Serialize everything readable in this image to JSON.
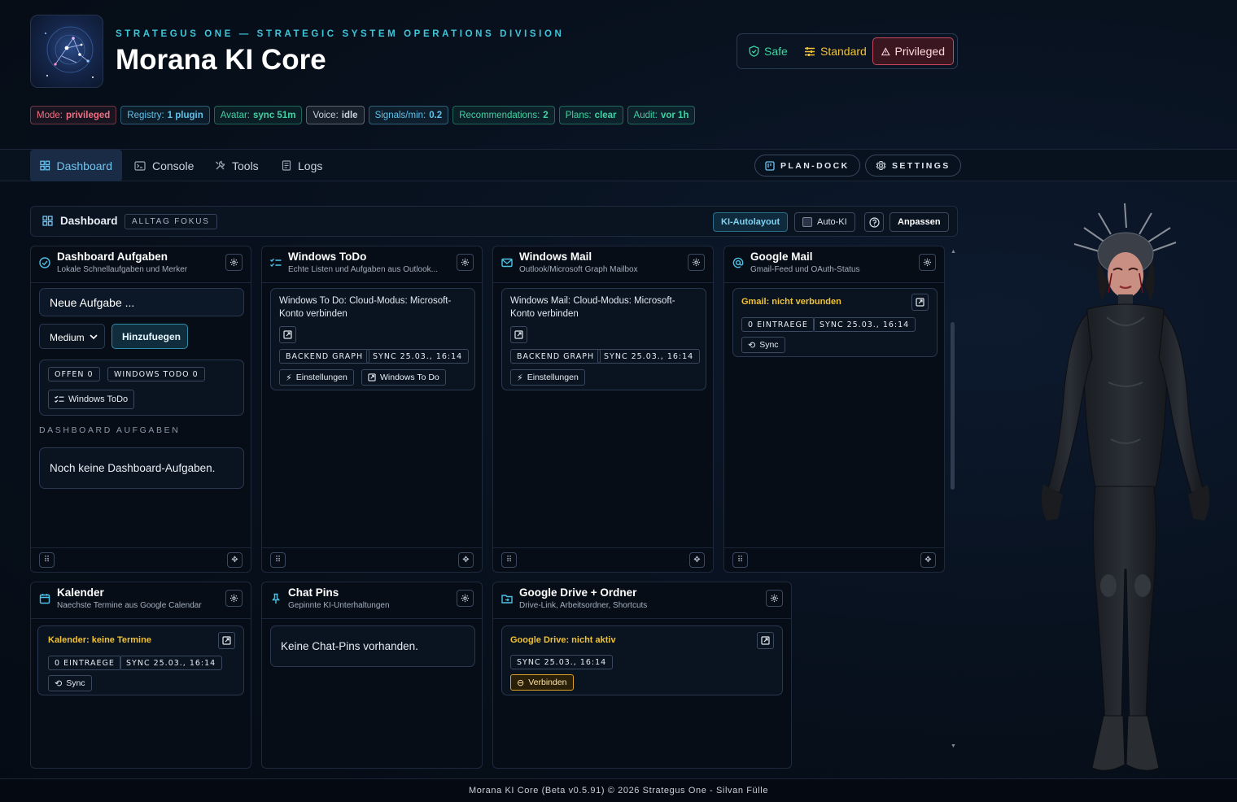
{
  "header": {
    "subtitle": "STRATEGUS ONE — STRATEGIC SYSTEM OPERATIONS DIVISION",
    "title": "Morana KI Core"
  },
  "modes": {
    "safe": "Safe",
    "standard": "Standard",
    "privileged": "Privileged",
    "active": "privileged"
  },
  "status_chips": [
    {
      "label": "Mode:",
      "value": "privileged",
      "color": "#f06f82"
    },
    {
      "label": "Registry:",
      "value": "1 plugin",
      "color": "#5fc2ea"
    },
    {
      "label": "Avatar:",
      "value": "sync 51m",
      "color": "#3fd3a3"
    },
    {
      "label": "Voice:",
      "value": "idle",
      "color": "#c9d3de"
    },
    {
      "label": "Signals/min:",
      "value": "0.2",
      "color": "#5fc2ea"
    },
    {
      "label": "Recommendations:",
      "value": "2",
      "color": "#3fd3a3"
    },
    {
      "label": "Plans:",
      "value": "clear",
      "color": "#3fd3a3"
    },
    {
      "label": "Audit:",
      "value": "vor 1h",
      "color": "#3fd3a3"
    }
  ],
  "nav": {
    "tabs": [
      "Dashboard",
      "Console",
      "Tools",
      "Logs"
    ],
    "active": "Dashboard",
    "plan_dock": "PLAN-DOCK",
    "settings": "SETTINGS"
  },
  "dashboard_bar": {
    "label": "Dashboard",
    "focus": "ALLTAG FOKUS",
    "ki_autolayout": "KI-Autolayout",
    "auto_ki": "Auto-KI",
    "anpassen": "Anpassen"
  },
  "cards": {
    "aufgaben": {
      "title": "Dashboard Aufgaben",
      "subtitle": "Lokale Schnellaufgaben und Merker",
      "new_task_placeholder": "Neue Aufgabe ...",
      "priority": "Medium",
      "add": "Hinzufuegen",
      "tag_open": "OFFEN 0",
      "tag_todo": "WINDOWS TODO 0",
      "todo_button": "Windows ToDo",
      "section": "DASHBOARD AUFGABEN",
      "empty": "Noch keine Dashboard-Aufgaben."
    },
    "todo": {
      "title": "Windows ToDo",
      "subtitle": "Echte Listen und Aufgaben aus Outlook...",
      "message": "Windows To Do: Cloud-Modus: Microsoft-Konto verbinden",
      "tag_backend": "BACKEND GRAPH",
      "tag_sync": "SYNC 25.03., 16:14",
      "btn_settings": "Einstellungen",
      "btn_open": "Windows To Do"
    },
    "mail": {
      "title": "Windows Mail",
      "subtitle": "Outlook/Microsoft Graph Mailbox",
      "message": "Windows Mail: Cloud-Modus: Microsoft-Konto verbinden",
      "tag_backend": "BACKEND GRAPH",
      "tag_sync": "SYNC 25.03., 16:14",
      "btn_settings": "Einstellungen"
    },
    "gmail": {
      "title": "Google Mail",
      "subtitle": "Gmail-Feed und OAuth-Status",
      "status": "Gmail: nicht verbunden",
      "tag_count": "0 EINTRAEGE",
      "tag_sync": "SYNC 25.03., 16:14",
      "btn_sync": "Sync"
    },
    "calendar": {
      "title": "Kalender",
      "subtitle": "Naechste Termine aus Google Calendar",
      "status": "Kalender: keine Termine",
      "tag_count": "0 EINTRAEGE",
      "tag_sync": "SYNC 25.03., 16:14",
      "btn_sync": "Sync"
    },
    "pins": {
      "title": "Chat Pins",
      "subtitle": "Gepinnte KI-Unterhaltungen",
      "empty": "Keine Chat-Pins vorhanden."
    },
    "drive": {
      "title": "Google Drive + Ordner",
      "subtitle": "Drive-Link, Arbeitsordner, Shortcuts",
      "status": "Google Drive: nicht aktiv",
      "tag_sync": "SYNC 25.03., 16:14",
      "btn_connect": "Verbinden"
    }
  },
  "footer": "Morana KI Core (Beta v0.5.91) © 2026 Strategus One - Silvan Fülle"
}
